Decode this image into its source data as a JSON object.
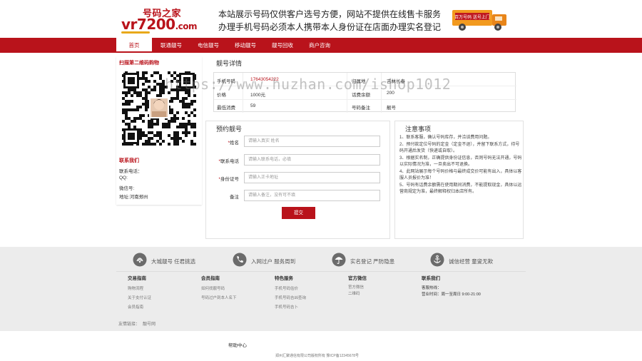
{
  "header": {
    "logo_cn": "号码之家",
    "logo_en": "vr7200",
    "logo_suffix": ".com",
    "slogan_line1": "本站展示号码仅供客户选号方便，网站不提供在线售卡服务",
    "slogan_line2": "办理手机号码必须本人携带本人身份证在店面办理实名登记",
    "truck_text": "百万号码 送号上门"
  },
  "nav": {
    "items": [
      {
        "label": "首页",
        "active": true
      },
      {
        "label": "联通靓号",
        "active": false
      },
      {
        "label": "电信靓号",
        "active": false
      },
      {
        "label": "移动靓号",
        "active": false
      },
      {
        "label": "靓号回收",
        "active": false
      },
      {
        "label": "商户咨询",
        "active": false
      }
    ]
  },
  "sidebar": {
    "qr_title": "扫描第二维码购物",
    "contact_title": "联系我们",
    "contact_person": "联系电话：",
    "qq": "QQ:",
    "wechat": "微信号:",
    "address": "地址:河南郑州"
  },
  "detail": {
    "title": "靓号详情",
    "rows": [
      {
        "label1": "手机号码",
        "value1": "17643054222",
        "label2": "归属地",
        "value2": "吉林长春"
      },
      {
        "label1": "价格",
        "value1": "1000元",
        "label2": "话费余额",
        "value2": "200"
      },
      {
        "label1": "最低消费",
        "value1": "59",
        "label2": "号码备注",
        "value2": "靓号"
      }
    ]
  },
  "form": {
    "title": "预约靓号",
    "name_label": "姓名",
    "name_placeholder": "请输入真实 姓名",
    "phone_label": "联系电话",
    "phone_placeholder": "请输入联系电话，必填",
    "id_label": "身份证号",
    "id_placeholder": "请输入正卡地址",
    "remark_label": "备注",
    "remark_placeholder": "请输入备注，没有可不填",
    "submit_label": "提交",
    "required_mark": "*"
  },
  "notes": {
    "title": "注意事项",
    "items": [
      "1、联系客服，确认号码库存，并洽谈费用问题。",
      "2、预付款定位号码的定金（定金不退），并留下联系方式，待号码开通后发货（快递或自取）。",
      "3、根据实名制，正确提供身份证信息，否则号码无法开通，号码以实际情况为准，一旦卖出不可退换。",
      "4、此网站展示每个号码价格与最终成交价可能有出入，具体以客服人员报价为准！",
      "5、号码有话费余额需在使用期间消费，不能提取现金，具体以运营商规定为准，最终解释权归本店所有。"
    ]
  },
  "footer": {
    "features": [
      {
        "icon": "signal-icon",
        "text": "大城靓号  任君挑选"
      },
      {
        "icon": "phone-icon",
        "text": "入网过户  服务周到"
      },
      {
        "icon": "umbrella-icon",
        "text": "实名登记  严防隐患"
      },
      {
        "icon": "anchor-icon",
        "text": "诚信经营  童叟无欺"
      }
    ],
    "columns": [
      {
        "title": "交易指南",
        "links": [
          "购物流程",
          "关于支付认证",
          "会员指南"
        ]
      },
      {
        "title": "会员指南",
        "links": [
          "如何找靓号码",
          "号码过户到本人名下"
        ]
      },
      {
        "title": "特色服务",
        "links": [
          "手机号码估价",
          "手机号码吉凶查询",
          "手机号码吉卜"
        ]
      },
      {
        "title": "官方微信",
        "links": [
          "官方微信",
          "二维码"
        ]
      },
      {
        "title": "联系我们",
        "links": [
          "客服热线：",
          "营业时间：周一至周日 9:00-21:00"
        ]
      }
    ],
    "friend_label": "友情链接：",
    "friend_link": "靓号网"
  },
  "bottom": {
    "help": "帮助中心",
    "copyright": "郑州汇聚通信有限公司版权所有 豫ICP备12345678号"
  },
  "watermark": "https://www.huzhan.com/ishop1012",
  "colors": {
    "brand_red": "#b9131b",
    "footer_bg": "#ececec"
  }
}
